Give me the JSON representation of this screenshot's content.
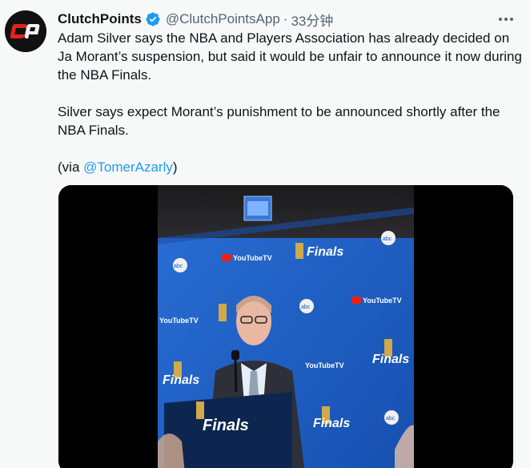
{
  "tweet": {
    "display_name": "ClutchPoints",
    "handle": "@ClutchPointsApp",
    "separator": "·",
    "time": "33分钟",
    "verified_color": "#1d9bf0",
    "more_icon": "more-horizontal-icon",
    "avatar_text": "CP",
    "paragraphs": {
      "p1": "Adam Silver says the NBA and Players Association has already decided on Ja Morant’s suspension, but said it would be unfair to announce it now during the NBA Finals.",
      "p2": "Silver says expect Morant’s punishment to be announced shortly after the NBA Finals.",
      "p3_prefix": "(via ",
      "p3_mention": "@TomerAzarly",
      "p3_suffix": ")"
    }
  },
  "media": {
    "backdrop_logos": {
      "youtube_tv": "YouTubeTV",
      "abc": "abc",
      "finals": "Finals"
    }
  },
  "colors": {
    "link": "#1d9bf0",
    "secondary": "#536471",
    "backdrop_blue": "#1e63c7"
  }
}
